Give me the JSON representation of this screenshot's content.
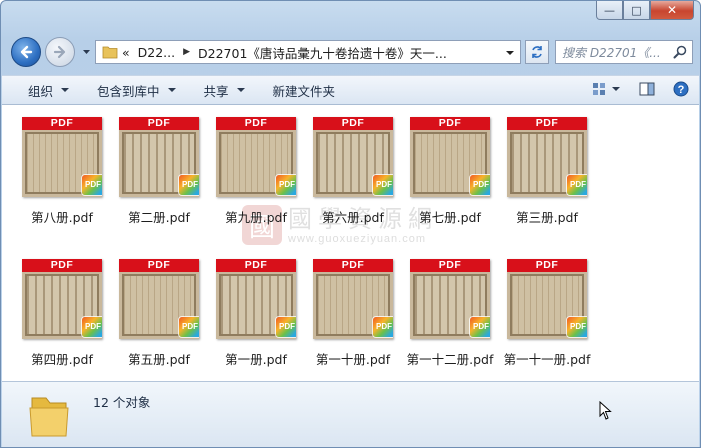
{
  "window": {
    "caption": {
      "minimize": "—",
      "maximize": "□",
      "close": "✕"
    }
  },
  "nav": {
    "back_icon": "back-arrow-icon",
    "forward_icon": "forward-arrow-icon",
    "address_segments": [
      "«",
      "D22...",
      "D22701《唐诗品彙九十卷拾遗十卷》天一..."
    ],
    "search_placeholder": "搜索 D22701《..."
  },
  "toolbar": {
    "organize": "组织",
    "include_in_library": "包含到库中",
    "share": "共享",
    "new_folder": "新建文件夹"
  },
  "files": [
    {
      "name": "第八册.pdf"
    },
    {
      "name": "第二册.pdf"
    },
    {
      "name": "第九册.pdf"
    },
    {
      "name": "第六册.pdf"
    },
    {
      "name": "第七册.pdf"
    },
    {
      "name": "第三册.pdf"
    },
    {
      "name": "第四册.pdf"
    },
    {
      "name": "第五册.pdf"
    },
    {
      "name": "第一册.pdf"
    },
    {
      "name": "第一十册.pdf"
    },
    {
      "name": "第一十二册.pdf"
    },
    {
      "name": "第一十一册.pdf"
    }
  ],
  "thumb": {
    "banner": "PDF",
    "badge": "PDF"
  },
  "watermark": {
    "cn": "國學資源網",
    "url": "www.guoxueziyuan.com",
    "seal": "國"
  },
  "status": {
    "count": "12 个对象"
  },
  "colors": {
    "pdf_banner": "#d8101a",
    "window_chrome": "#bdd3ea"
  }
}
